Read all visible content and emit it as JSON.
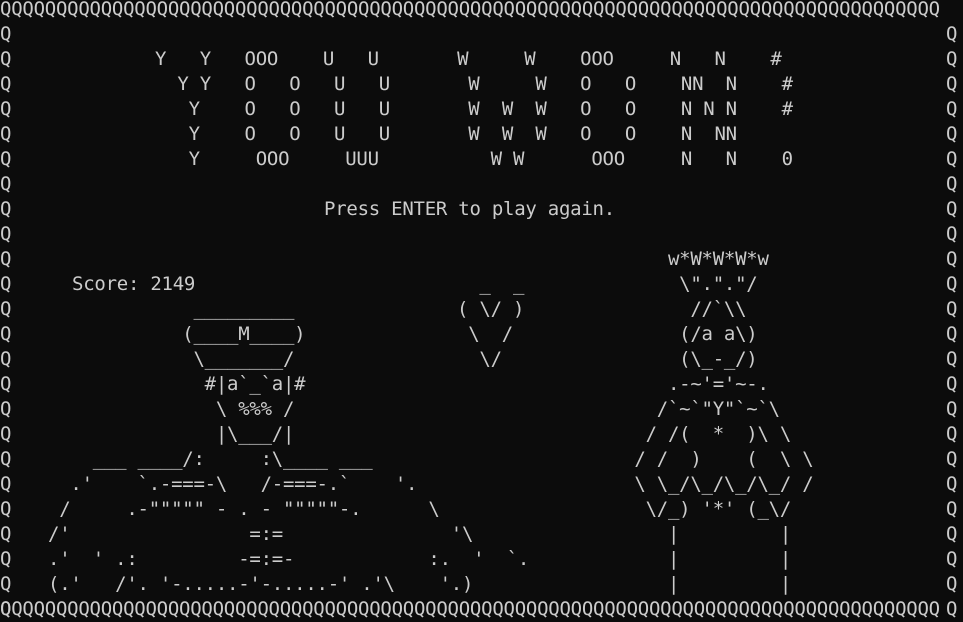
{
  "screen": {
    "border_top": "QQQQQQQQQQQQQQQQQQQQQQQQQQQQQQQQQQQQQQQQQQQQQQQQQQQQQQQQQQQQQQQQQQQQQQQQQQQQQQQQQQQQ",
    "border_bottom": "QQQQQQQQQQQQQQQQQQQQQQQQQQQQQQQQQQQQQQQQQQQQQQQQQQQQQQQQQQQQQQQQQQQQQQQQQQQQQQQQQQQQ",
    "border_side": "Q\nQ\nQ\nQ\nQ\nQ\nQ\nQ\nQ\nQ\nQ\nQ\nQ\nQ\nQ\nQ\nQ\nQ\nQ\nQ\nQ\nQ\nQ\nQ",
    "colors": {
      "background": "#0c0c0c",
      "text": "#cccccc"
    }
  },
  "banner": {
    "art": "Y   Y   OOO    U   U       W     W    OOO     N   N    #\n  Y Y   O   O   U   U       W     W   O   O    NN  N    #\n   Y    O   O   U   U       W  W  W   O   O    N N N    #\n   Y    O   O   U   U       W  W  W   O   O    N  NN\n   Y     OOO     UUU          W W      OOO     N   N    0"
  },
  "prompt": {
    "text": "Press ENTER to play again."
  },
  "score": {
    "text": "Score: 2149"
  },
  "hero": {
    "art": "             _________\n            (____M____)\n             \\_______/\n              #|a`_`a|#\n               \\ %%% /\n               |\\___/|\n    ___ ____/:     :\\____ ___\n  .'    `.-===-\\   /-===-.`    '.\n /     .-\"\"\"\"\" - . - \"\"\"\"\"-.      \\\n/'                =:=               '\\\n.'  ' .:         -=:=-            :.  '  `.\n(.'   /'. '-.....-'-.....-' .'\\    '.)"
  },
  "heart": {
    "art": "  _  _\n( \\/ )\n \\  /\n  \\/"
  },
  "princess": {
    "art": "     w*W*W*W*w\n      \\\".\".\"/\n       //`\\\\\n      (/a a\\)\n      (\\_-_/)\n     .-~'='~-.\n    /`~`\"Y\"`~`\\\n   / /(  *  )\\ \\\n  / /  )    (  \\ \\\n  \\ \\_/\\_/\\_/\\_/ /\n   \\/_) '*' (_\\/\n     |         |\n     |         |\n     |         |"
  }
}
